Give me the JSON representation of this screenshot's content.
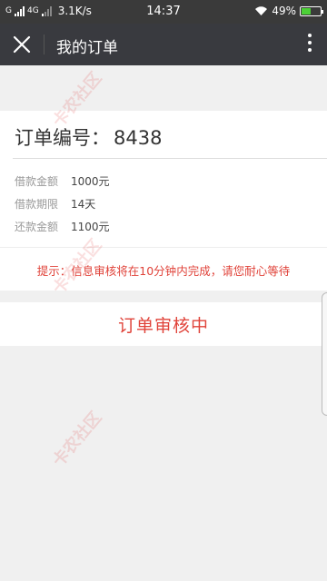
{
  "status_bar": {
    "carrier1": "G",
    "carrier2": "4G",
    "speed": "3.1K/s",
    "time": "14:37",
    "battery": "49%",
    "battery_level": 0.49
  },
  "header": {
    "title": "我的订单",
    "close_icon": "close-icon",
    "more_icon": "more-vertical-icon"
  },
  "order": {
    "number_label": "订单编号：",
    "number": "8438",
    "rows": [
      {
        "label": "借款金额",
        "value": "1000元"
      },
      {
        "label": "借款期限",
        "value": "14天"
      },
      {
        "label": "还款金额",
        "value": "1100元"
      }
    ],
    "notice": "提示：信息审核将在10分钟内完成，请您耐心等待"
  },
  "status": {
    "label": "订单审核中"
  },
  "watermark": {
    "text": "卡农社区"
  },
  "colors": {
    "accent": "#e0433a",
    "header_bg": "#393a3f",
    "page_bg": "#f0f0f0"
  }
}
